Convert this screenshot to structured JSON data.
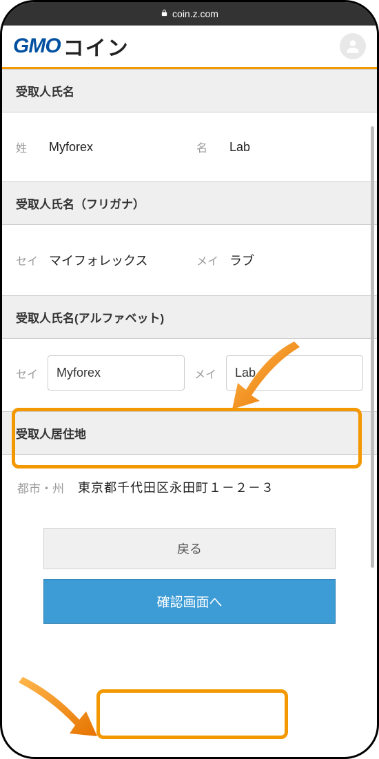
{
  "url": "coin.z.com",
  "logo": {
    "gmo": "GMO",
    "coin": "コイン"
  },
  "sections": {
    "name": {
      "header": "受取人氏名",
      "sei_label": "姓",
      "sei_value": "Myforex",
      "mei_label": "名",
      "mei_value": "Lab"
    },
    "furigana": {
      "header": "受取人氏名（フリガナ）",
      "sei_label": "セイ",
      "sei_value": "マイフォレックス",
      "mei_label": "メイ",
      "mei_value": "ラブ"
    },
    "alphabet": {
      "header": "受取人氏名(アルファベット)",
      "sei_label": "セイ",
      "sei_value": "Myforex",
      "mei_label": "メイ",
      "mei_value": "Lab"
    },
    "address": {
      "header": "受取人居住地",
      "label": "都市・州",
      "value": "東京都千代田区永田町１－２－３"
    }
  },
  "buttons": {
    "back": "戻る",
    "confirm": "確認画面へ"
  }
}
